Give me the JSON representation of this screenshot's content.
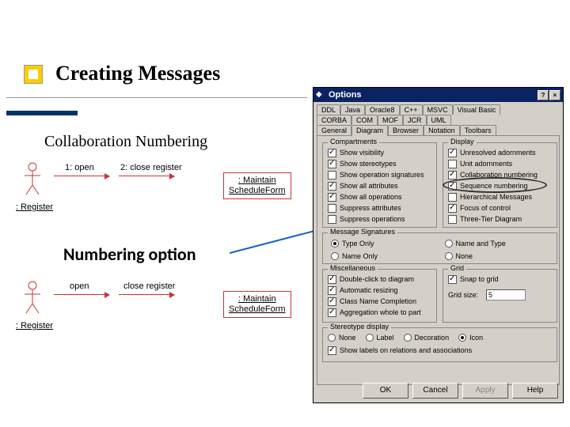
{
  "slide": {
    "title": "Creating Messages",
    "subtitle": "Collaboration Numbering",
    "numbering_label": "Numbering option"
  },
  "uml": {
    "actor_label": ": Register",
    "obj_line1": ": Maintain",
    "obj_line2": "ScheduleForm",
    "top": {
      "msg1": "1: open",
      "msg2": "2: close register"
    },
    "bot": {
      "msg1": "open",
      "msg2": "close register"
    }
  },
  "dialog": {
    "title": "Options",
    "close": "×",
    "help": "?",
    "tabs_row1": [
      "DDL",
      "Java",
      "Oracle8",
      "C++",
      "MSVC",
      "Visual Basic"
    ],
    "tabs_row2": [
      "CORBA",
      "COM",
      "MOF",
      "JCR",
      "UML"
    ],
    "tabs_row3": [
      "General",
      "Diagram",
      "Browser",
      "Notation",
      "Toolbars"
    ],
    "active_tab": "Diagram",
    "groups": {
      "compartments": {
        "title": "Compartments",
        "items": [
          {
            "label": "Show visibility",
            "checked": true
          },
          {
            "label": "Show stereotypes",
            "checked": true
          },
          {
            "label": "Show operation signatures",
            "checked": false
          },
          {
            "label": "Show all attributes",
            "checked": true
          },
          {
            "label": "Show all operations",
            "checked": true
          },
          {
            "label": "Suppress attributes",
            "checked": false
          },
          {
            "label": "Suppress operations",
            "checked": false
          }
        ]
      },
      "display": {
        "title": "Display",
        "items": [
          {
            "label": "Unresolved adornments",
            "checked": true
          },
          {
            "label": "Unit adornments",
            "checked": false
          },
          {
            "label": "Collaboration numbering",
            "checked": true
          },
          {
            "label": "Sequence numbering",
            "checked": true
          },
          {
            "label": "Hierarchical Messages",
            "checked": false
          },
          {
            "label": "Focus of control",
            "checked": true
          },
          {
            "label": "Three-Tier Diagram",
            "checked": false
          }
        ]
      },
      "msg_sigs": {
        "title": "Message Signatures",
        "items": [
          {
            "label": "Type Only",
            "checked": true
          },
          {
            "label": "Name Only",
            "checked": false
          },
          {
            "label": "Name and Type",
            "checked": false
          },
          {
            "label": "None",
            "checked": false
          }
        ]
      },
      "misc": {
        "title": "Miscellaneous",
        "items": [
          {
            "label": "Double-click to diagram",
            "checked": true
          },
          {
            "label": "Automatic resizing",
            "checked": true
          },
          {
            "label": "Class Name Completion",
            "checked": true
          },
          {
            "label": "Aggregation whole to part",
            "checked": true
          }
        ]
      },
      "grid": {
        "title": "Grid",
        "snap": {
          "label": "Snap to grid",
          "checked": true
        },
        "size_label": "Grid size:",
        "size_value": "5"
      },
      "stereo": {
        "title": "Stereotype display",
        "items": [
          {
            "label": "None",
            "checked": false
          },
          {
            "label": "Label",
            "checked": false
          },
          {
            "label": "Decoration",
            "checked": false
          },
          {
            "label": "Icon",
            "checked": true
          }
        ],
        "show_labels": {
          "label": "Show labels on relations and associations",
          "checked": true
        }
      }
    },
    "buttons": {
      "ok": "OK",
      "cancel": "Cancel",
      "apply": "Apply",
      "help": "Help"
    }
  }
}
